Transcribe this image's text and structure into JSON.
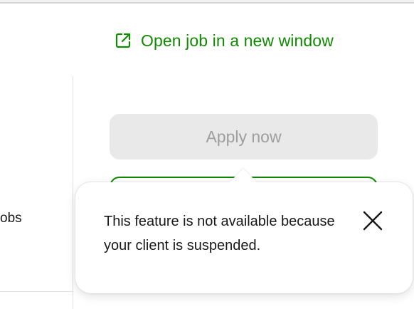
{
  "header": {
    "open_job_link": {
      "label": "Open job in a new window",
      "icon": "external-link-icon"
    }
  },
  "left_panel": {
    "partial_text": "obs"
  },
  "actions": {
    "apply_label": "Apply now",
    "apply_state": "disabled"
  },
  "popover": {
    "message": "This feature is not available because your client is suspended.",
    "close_icon": "close-icon"
  },
  "colors": {
    "accent": "#108a00",
    "disabled_bg": "#e9e9e9",
    "disabled_text": "#9e9e9e",
    "text": "#181818"
  }
}
